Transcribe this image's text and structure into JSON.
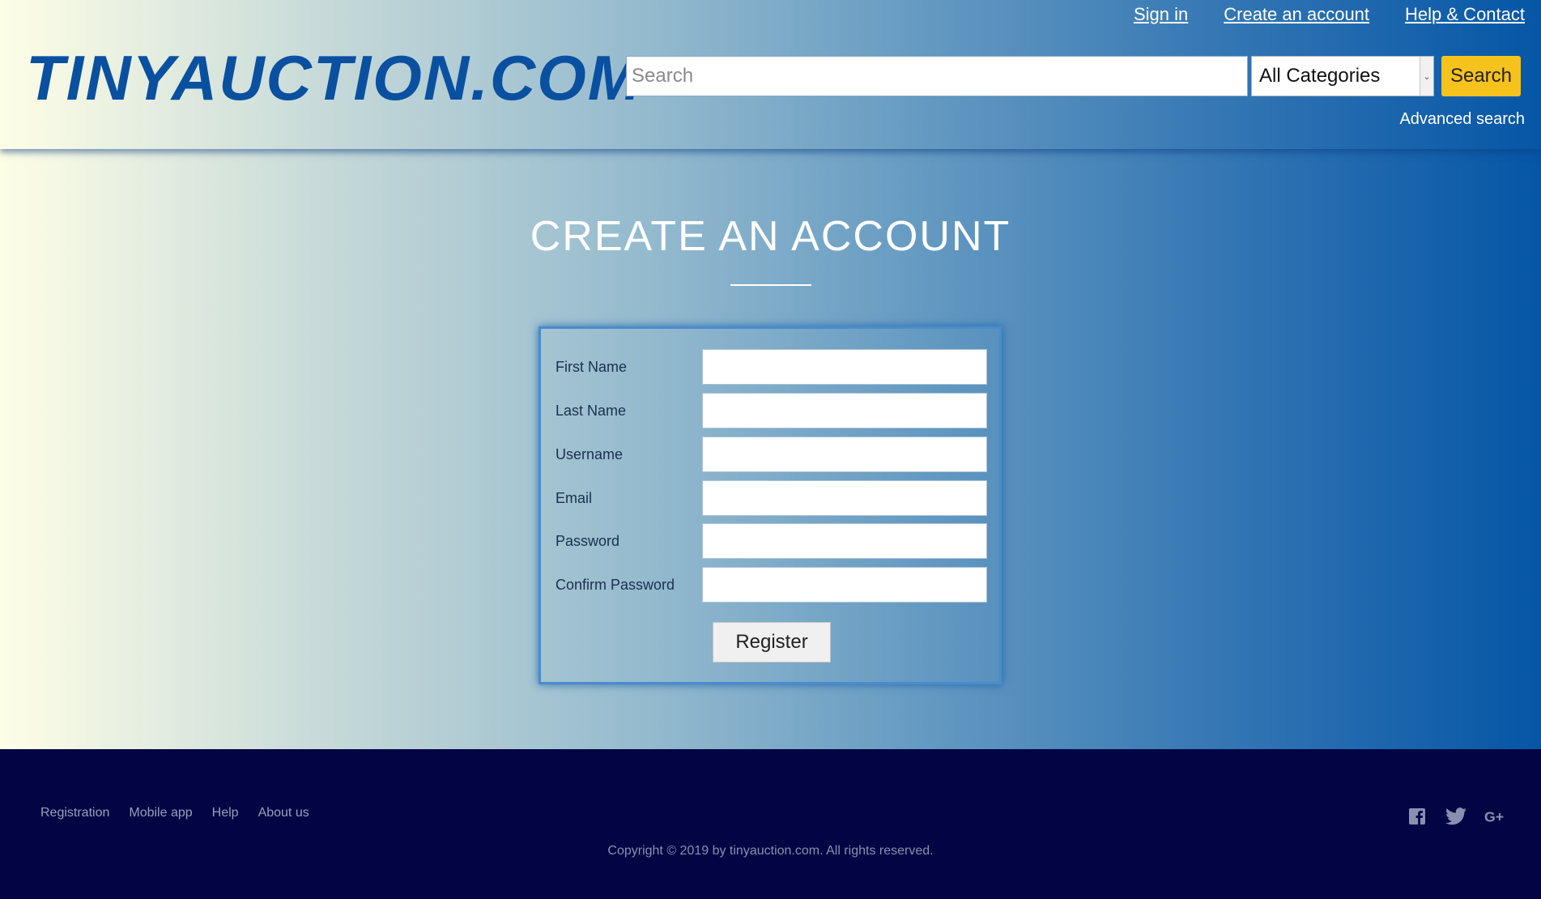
{
  "header": {
    "logo": "TINYAUCTION.COM",
    "links": {
      "sign_in": "Sign in",
      "create_account": "Create an account",
      "help_contact": "Help & Contact"
    },
    "search": {
      "placeholder": "Search",
      "category": "All Categories",
      "button": "Search"
    },
    "advanced_search": "Advanced search"
  },
  "main": {
    "title": "CREATE AN ACCOUNT",
    "form": {
      "fields": [
        {
          "label": "First Name"
        },
        {
          "label": "Last Name"
        },
        {
          "label": "Username"
        },
        {
          "label": "Email"
        },
        {
          "label": "Password"
        },
        {
          "label": "Confirm Password"
        }
      ],
      "submit": "Register"
    }
  },
  "footer": {
    "links": [
      "Registration",
      "Mobile app",
      "Help",
      "About us"
    ],
    "copyright": "Copyright © 2019 by tinyauction.com. All rights reserved.",
    "social_icons": [
      "facebook-icon",
      "twitter-icon",
      "google-plus-icon"
    ]
  },
  "colors": {
    "logo": "#0a50a0",
    "search_button": "#f6c21c",
    "footer_bg": "#020444",
    "gradient_start": "#fefee6",
    "gradient_end": "#0556a6"
  }
}
